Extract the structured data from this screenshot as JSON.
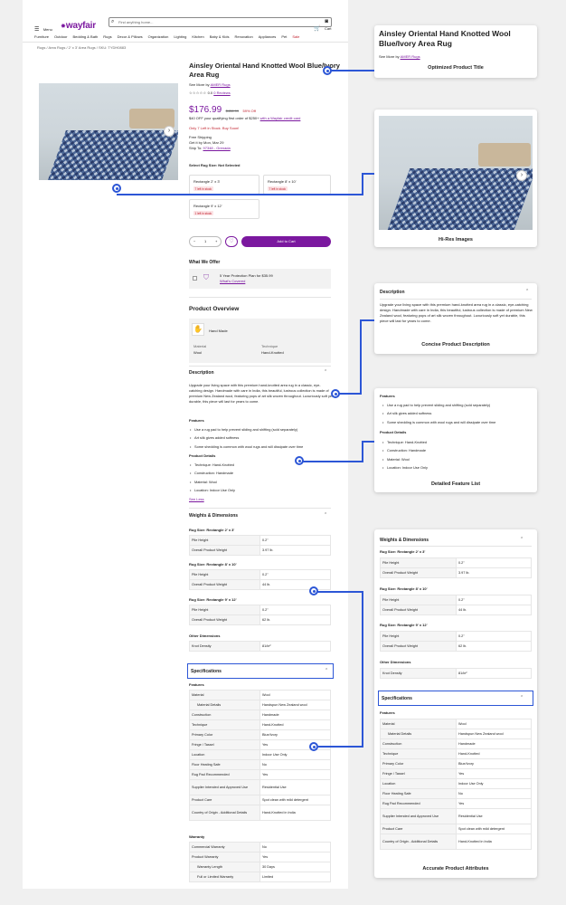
{
  "header": {
    "menu_label": "Menu",
    "logo": "wayfair",
    "search_placeholder": "Find anything home...",
    "cart_label": "Cart",
    "nav": [
      "Furniture",
      "Outdoor",
      "Bedding & Bath",
      "Rugs",
      "Decor & Pillows",
      "Organization",
      "Lighting",
      "Kitchen",
      "Baby & Kids",
      "Renovation",
      "Appliances",
      "Pet",
      "Sale"
    ],
    "breadcrumb": "Rugs / Area Rugs / 2' x 3' Area Rugs / SKU: TYDH0883"
  },
  "product": {
    "title": "Ainsley Oriental Hand Knotted Wool Blue/Ivory Area Rug",
    "see_more": "See More by",
    "brand": "AMER Rugs",
    "rating": "0.0",
    "reviews": "0 Reviews",
    "price": "$176.99",
    "old_price": "$436.99",
    "discount": "59% Off",
    "offer": "$40 OFF your qualifying first order of $250+",
    "offer_link": "with a Wayfair credit card",
    "stock": "Only 7 Left in Stock. Buy Soon!",
    "shipping": "Free Shipping",
    "delivery": "Get it by Mon, Mar 29",
    "ship_to": "Ship To:",
    "zip": "97348 - Grenada",
    "size_label": "Select Rug Size: Not Selected",
    "sizes": [
      {
        "name": "Rectangle 2' x 3'",
        "badge": "7 left in stock"
      },
      {
        "name": "Rectangle 8' x 10'",
        "badge": "7 left in stock"
      },
      {
        "name": "Rectangle 9' x 12'",
        "badge": "1 left in stock"
      }
    ],
    "qty": "1",
    "add_to_cart": "Add to Cart"
  },
  "offer_section": {
    "title": "What We Offer",
    "plan": "5 Year Protection Plan for $35.99",
    "plan_link": "What's Covered"
  },
  "overview": {
    "title": "Product Overview",
    "feature": "Hand Made",
    "material_label": "Material",
    "material": "Wool",
    "technique_label": "Technique",
    "technique": "Hand-Knotted"
  },
  "description": {
    "title": "Description",
    "text": "Upgrade your living space with this premium hand-knotted area rug in a classic, eye-catching design. Handmade with care in India, this beautiful, lustrous collection is made of premium New Zealand wool, featuring pops of art silk woven throughout. Luxuriously soft yet durable, this piece will last for years to come.",
    "features_title": "Features",
    "features": [
      "Use a rug pad to help prevent sliding and shifting (sold separately)",
      "Art silk gives added softness",
      "Some shedding is common with wool rugs and will dissipate over time"
    ],
    "details_title": "Product Details",
    "details": [
      "Technique: Hand-Knotted",
      "Construction: Handmade",
      "Material: Wool",
      "Location: Indoor Use Only"
    ],
    "see_less": "See Less"
  },
  "weights": {
    "title": "Weights & Dimensions",
    "groups": [
      {
        "label": "Rug Size: Rectangle 2' x 3'",
        "rows": [
          [
            "Pile Height",
            "0.2\""
          ],
          [
            "Overall Product Weight",
            "3.97 lb."
          ]
        ]
      },
      {
        "label": "Rug Size: Rectangle 8' x 10'",
        "rows": [
          [
            "Pile Height",
            "0.2\""
          ],
          [
            "Overall Product Weight",
            "44 lb."
          ]
        ]
      },
      {
        "label": "Rug Size: Rectangle 9' x 12'",
        "rows": [
          [
            "Pile Height",
            "0.2\""
          ],
          [
            "Overall Product Weight",
            "62 lb."
          ]
        ]
      }
    ],
    "other_label": "Other Dimensions",
    "other_rows": [
      [
        "Knot Density",
        "81/in²"
      ]
    ]
  },
  "specs": {
    "title": "Specifications",
    "features_label": "Features",
    "rows": [
      [
        "Material",
        "Wool"
      ],
      [
        "Material Details",
        "Handspun New Zealand wool"
      ],
      [
        "Construction",
        "Handmade"
      ],
      [
        "Technique",
        "Hand-Knotted"
      ],
      [
        "Primary Color",
        "Blue/Ivory"
      ],
      [
        "Fringe / Tassel",
        "Yes"
      ],
      [
        "Location",
        "Indoor Use Only"
      ],
      [
        "Floor Heating Safe",
        "No"
      ],
      [
        "Rug Pad Recommended",
        "Yes"
      ],
      [
        "Supplier Intended and Approved Use",
        "Residential Use"
      ],
      [
        "Product Care",
        "Spot clean with mild detergent"
      ],
      [
        "Country of Origin - Additional Details",
        "Hand-Knotted in India"
      ]
    ],
    "warranty_label": "Warranty",
    "warranty_rows": [
      [
        "Commercial Warranty",
        "No"
      ],
      [
        "Product Warranty",
        "Yes"
      ],
      [
        "Warranty Length",
        "30 Days"
      ],
      [
        "Full or Limited Warranty",
        "Limited"
      ]
    ]
  },
  "captions": {
    "title": "Optimized Product Title",
    "images": "Hi-Res Images",
    "description": "Concise Product Description",
    "features": "Detailed Feature List",
    "attributes": "Accurate Product Attributes"
  },
  "colors": {
    "brand": "#7b189f",
    "callout": "#2c56d6"
  },
  "icons": [
    "menu-icon",
    "search-icon",
    "camera-icon",
    "cart-icon",
    "star-icon",
    "heart-icon",
    "chevron-right-icon",
    "chevron-up-icon",
    "shield-icon",
    "hand-icon"
  ]
}
